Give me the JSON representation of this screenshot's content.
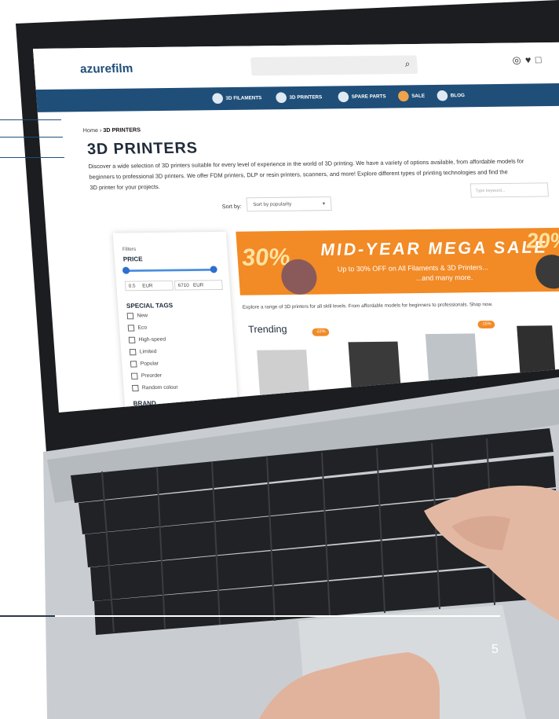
{
  "site": {
    "logo": "azurefilm",
    "search_icon": "search-icon",
    "header_icons": [
      "user-icon",
      "heart-icon",
      "cart-icon"
    ],
    "nav": [
      {
        "label": "3D FILAMENTS"
      },
      {
        "label": "3D PRINTERS"
      },
      {
        "label": "SPARE PARTS"
      },
      {
        "label": "SALE"
      },
      {
        "label": "BLOG"
      }
    ],
    "breadcrumb": {
      "home": "Home",
      "separator": "›",
      "current": "3D PRINTERS"
    },
    "title": "3D PRINTERS",
    "intro_line1": "Discover a wide selection of 3D printers suitable for every level of experience in the world of 3D printing. We have a variety of options available, from affordable models for",
    "intro_line2": "beginners to professional 3D printers. We offer FDM printers, DLP or resin printers, scanners, and more! Explore different types of printing technologies and find the",
    "intro_line3": "3D printer for your projects.",
    "sort_label": "Sort by:",
    "sort_value": "Sort by popularity",
    "keyword_placeholder": "Type keyword...",
    "filters": {
      "heading_small": "Filters",
      "price_heading": "PRICE",
      "price_min": "0.5",
      "price_min_unit": "EUR",
      "price_max": "6710",
      "price_max_unit": "EUR",
      "tags_heading": "SPECIAL TAGS",
      "tags": [
        "New",
        "Eco",
        "High-speed",
        "Limited",
        "Popular",
        "Preorder",
        "Random colour"
      ],
      "brand_heading": "BRAND"
    },
    "banner": {
      "pct_left": "30%",
      "title": "MID-YEAR MEGA SALE",
      "sub1": "Up to 30% OFF on All Filaments & 3D Printers...",
      "sub2": "...and many more.",
      "pct_right": "20%"
    },
    "explore_text": "Explore a range of 3D printers for all skill levels. From affordable models for beginners to professionals. Shop now.",
    "trending": "Trending",
    "badges": [
      "-22%",
      "-15%"
    ]
  },
  "page_number": "5",
  "colors": {
    "brand_blue": "#1f4e79",
    "sale_orange": "#f28a25"
  }
}
